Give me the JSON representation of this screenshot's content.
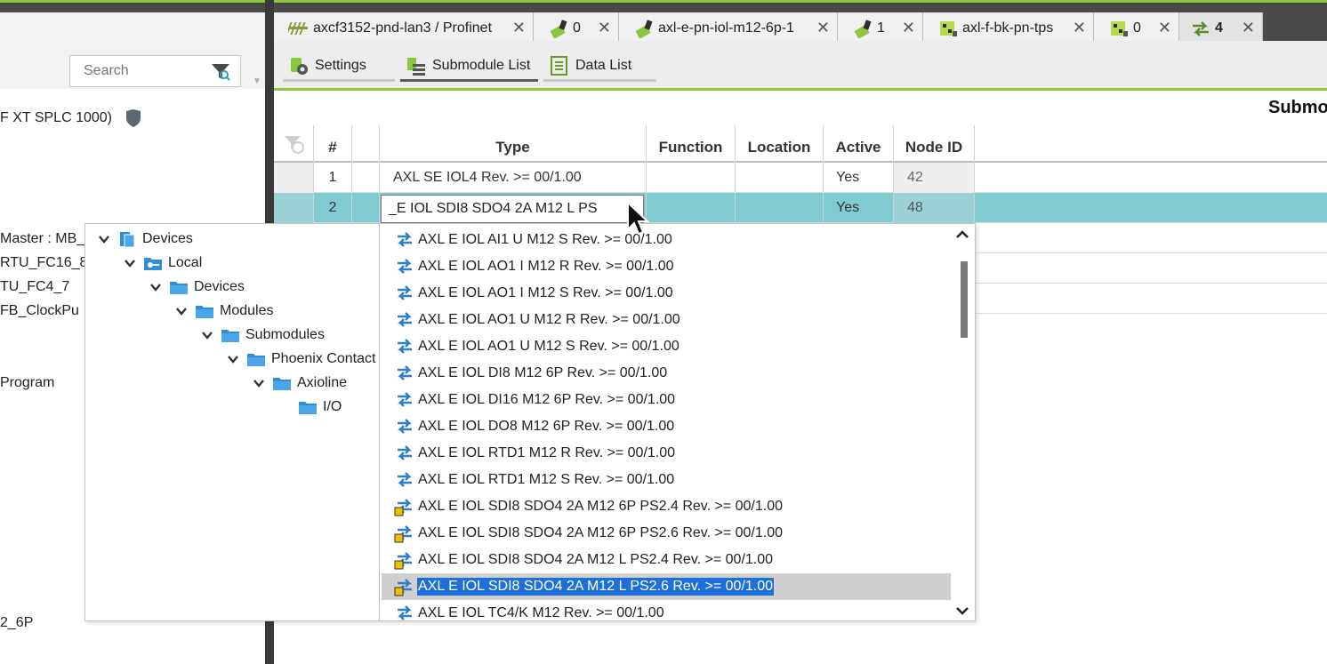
{
  "left_panel": {
    "search_placeholder": "Search",
    "visible_items": [
      " F XT SPLC 1000)",
      "Master : MB_A",
      "RTU_FC16_8",
      "TU_FC4_7",
      "FB_ClockPu",
      "Program",
      "2_6P"
    ]
  },
  "tabs": [
    {
      "label": "axcf3152-pnd-lan3 / Profinet",
      "icon": "profinet-bus-icon"
    },
    {
      "label": "0",
      "icon": "axioline-module-icon"
    },
    {
      "label": "axl-e-pn-iol-m12-6p-1",
      "icon": "axioline-module-icon"
    },
    {
      "label": "1",
      "icon": "axioline-module-icon"
    },
    {
      "label": "axl-f-bk-pn-tps",
      "icon": "bus-coupler-icon"
    },
    {
      "label": "0",
      "icon": "bus-coupler-icon"
    },
    {
      "label": "4",
      "icon": "submodule-arrows-icon",
      "active": true
    }
  ],
  "editor_toolbar": {
    "settings": "Settings",
    "submodule_list": "Submodule List",
    "data_list": "Data List"
  },
  "submodule_title": "Submo",
  "grid": {
    "columns": [
      "#",
      "",
      "Type",
      "Function",
      "Location",
      "Active",
      "Node ID"
    ],
    "rows": [
      {
        "num": "1",
        "type": "AXL SE IOL4 Rev. >= 00/1.00",
        "function": "",
        "location": "",
        "active": "Yes",
        "node_id": "42"
      },
      {
        "num": "2",
        "type": "",
        "function": "",
        "location": "",
        "active": "Yes",
        "node_id": "48",
        "selected": true
      }
    ]
  },
  "combo": {
    "value": "_E IOL SDI8 SDO4 2A M12 L PS"
  },
  "catalog_tree": [
    {
      "label": "Devices",
      "level": 0,
      "icon": "devices-icon"
    },
    {
      "label": "Local",
      "level": 1,
      "icon": "local-repository-icon"
    },
    {
      "label": "Devices",
      "level": 2,
      "icon": "folder-icon"
    },
    {
      "label": "Modules",
      "level": 3,
      "icon": "folder-icon"
    },
    {
      "label": "Submodules",
      "level": 4,
      "icon": "folder-icon"
    },
    {
      "label": "Phoenix Contact",
      "level": 5,
      "icon": "folder-icon"
    },
    {
      "label": "Axioline",
      "level": 6,
      "icon": "folder-icon"
    },
    {
      "label": "I/O",
      "level": 7,
      "icon": "folder-icon",
      "leaf": true
    }
  ],
  "catalog_list": [
    {
      "label": "AXL E IOL AI1 U M12 S Rev. >= 00/1.00",
      "safety": false
    },
    {
      "label": "AXL E IOL AO1 I M12 R Rev. >= 00/1.00",
      "safety": false
    },
    {
      "label": "AXL E IOL AO1 I M12 S Rev. >= 00/1.00",
      "safety": false
    },
    {
      "label": "AXL E IOL AO1 U M12 R Rev. >= 00/1.00",
      "safety": false
    },
    {
      "label": "AXL E IOL AO1 U M12 S Rev. >= 00/1.00",
      "safety": false
    },
    {
      "label": "AXL E IOL DI8 M12 6P Rev. >= 00/1.00",
      "safety": false
    },
    {
      "label": "AXL E IOL DI16 M12 6P Rev. >= 00/1.00",
      "safety": false
    },
    {
      "label": "AXL E IOL DO8 M12 6P Rev. >= 00/1.00",
      "safety": false
    },
    {
      "label": "AXL E IOL RTD1 M12 R Rev. >= 00/1.00",
      "safety": false
    },
    {
      "label": "AXL E IOL RTD1 M12 S Rev. >= 00/1.00",
      "safety": false
    },
    {
      "label": "AXL E IOL SDI8 SDO4 2A M12 6P PS2.4 Rev. >= 00/1.00",
      "safety": true
    },
    {
      "label": "AXL E IOL SDI8 SDO4 2A M12 6P PS2.6 Rev. >= 00/1.00",
      "safety": true
    },
    {
      "label": "AXL E IOL SDI8 SDO4 2A M12 L PS2.4 Rev. >= 00/1.00",
      "safety": true
    },
    {
      "label": "AXL E IOL SDI8 SDO4 2A M12 L PS2.6 Rev. >= 00/1.00",
      "safety": true,
      "highlighted": true
    },
    {
      "label": "AXL E IOL TC4/K M12 Rev. >= 00/1.00",
      "safety": false
    }
  ],
  "colors": {
    "accent_green": "#8dc63f",
    "selected_row": "#7fcbcf",
    "selection_blue": "#1e6fd9",
    "dark_chrome": "#4a4a4a"
  }
}
